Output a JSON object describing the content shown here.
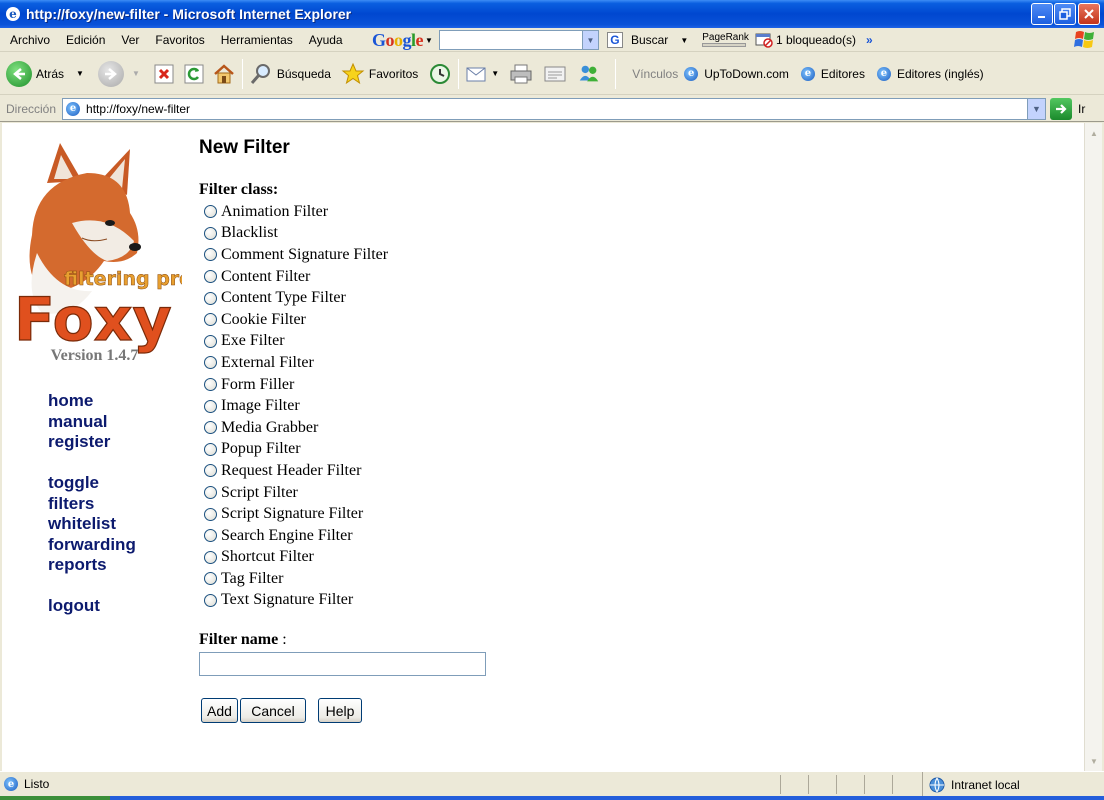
{
  "window": {
    "title": "http://foxy/new-filter - Microsoft Internet Explorer"
  },
  "menu": {
    "items": [
      "Archivo",
      "Edición",
      "Ver",
      "Favoritos",
      "Herramientas",
      "Ayuda"
    ],
    "google": {
      "logo": "Google",
      "search_label": "Buscar",
      "pagerank_label": "PageRank",
      "blocked_label": "1 bloqueado(s)",
      "more": "»"
    }
  },
  "toolbar": {
    "back_label": "Atrás",
    "search_label": "Búsqueda",
    "favorites_label": "Favoritos",
    "links_label": "Vínculos",
    "links": [
      "UpToDown.com",
      "Editores",
      "Editores (inglés)"
    ]
  },
  "address": {
    "label": "Dirección",
    "url": "http://foxy/new-filter",
    "go_label": "Ir"
  },
  "sidebar": {
    "logo_subtitle": "filtering proxy",
    "logo_word": "Foxy",
    "version": "Version 1.4.7",
    "nav_group_1": [
      "home",
      "manual",
      "register"
    ],
    "nav_group_2": [
      "toggle",
      "filters",
      "whitelist",
      "forwarding",
      "reports"
    ],
    "nav_group_3": [
      "logout"
    ]
  },
  "form": {
    "title": "New Filter",
    "class_label": "Filter class:",
    "classes": [
      "Animation Filter",
      "Blacklist",
      "Comment Signature Filter",
      "Content Filter",
      "Content Type Filter",
      "Cookie Filter",
      "Exe Filter",
      "External Filter",
      "Form Filler",
      "Image Filter",
      "Media Grabber",
      "Popup Filter",
      "Request Header Filter",
      "Script Filter",
      "Script Signature Filter",
      "Search Engine Filter",
      "Shortcut Filter",
      "Tag Filter",
      "Text Signature Filter"
    ],
    "name_label": "Filter name",
    "name_suffix": " :",
    "name_value": "",
    "buttons": {
      "add": "Add",
      "cancel": "Cancel",
      "help": "Help"
    }
  },
  "status": {
    "left": "Listo",
    "zone": "Intranet local"
  }
}
